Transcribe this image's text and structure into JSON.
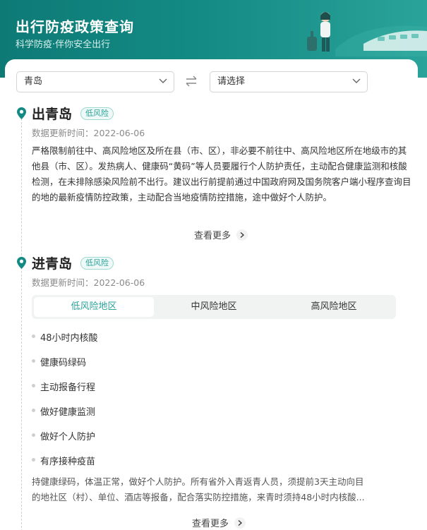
{
  "header": {
    "title": "出行防疫政策查询",
    "subtitle": "科学防疫·伴你安全出行"
  },
  "route": {
    "from_value": "青岛",
    "to_placeholder": "请选择"
  },
  "departure": {
    "title": "出青岛",
    "risk": "低风险",
    "updated": "数据更新时间：2022-06-06",
    "policy": "严格限制前往中、高风险地区及所在县（市、区），非必要不前往中、高风险地区所在地级市的其他县（市、区）。发热病人、健康码“黄码”等人员要履行个人防护责任，主动配合健康监测和核酸检测，在未排除感染风险前不出行。建议出行前提前通过中国政府网及国务院客户端小程序查询目的地的最新疫情防控政策，主动配合当地疫情防控措施，途中做好个人防护。",
    "more_label": "查看更多"
  },
  "arrival": {
    "title": "进青岛",
    "risk": "低风险",
    "updated": "数据更新时间：2022-06-06",
    "tabs": [
      "低风险地区",
      "中风险地区",
      "高风险地区"
    ],
    "active_tab": "低风险地区",
    "requirements": [
      "48小时内核酸",
      "健康码绿码",
      "主动报备行程",
      "做好健康监测",
      "做好个人防护",
      "有序接种疫苗"
    ],
    "note_line1": "持健康绿码，体温正常，做好个人防护。所有省外入青返青人员，须提前3天主动向目",
    "note_line2": "的地社区（村）、单位、酒店等报备，配合落实防控措施，来青时须持48小时内核酸...",
    "more_label": "查看更多"
  },
  "colors": {
    "brand": "#138a84",
    "accent": "#2aa39a"
  }
}
